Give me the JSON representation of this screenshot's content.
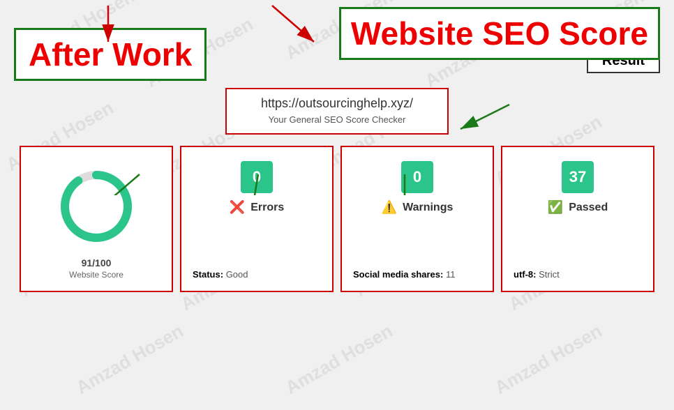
{
  "watermarks": [
    "Amzad Hosen",
    "Amzad Hosen",
    "Amzad Hosen",
    "Amzad Hosen",
    "Amzad Hosen",
    "Amzad Hosen",
    "Amzad Hosen",
    "Amzad Hosen",
    "Amzad Hosen"
  ],
  "header": {
    "after_work_label": "After Work",
    "result_label": "Result",
    "seo_score_label": "Website SEO Score"
  },
  "url_section": {
    "url": "https://outsourcinghelp.xyz/",
    "subtitle": "Your General SEO Score Checker"
  },
  "cards": [
    {
      "type": "score",
      "score_text": "91/100",
      "score_label": "Website Score",
      "score_percent": 91
    },
    {
      "type": "badge",
      "badge_value": "0",
      "icon": "error",
      "icon_label": "Errors",
      "status_label": "Status:",
      "status_value": "Good"
    },
    {
      "type": "badge",
      "badge_value": "0",
      "icon": "warning",
      "icon_label": "Warnings",
      "status_label": "Social media shares:",
      "status_value": "11"
    },
    {
      "type": "badge",
      "badge_value": "37",
      "icon": "pass",
      "icon_label": "Passed",
      "status_label": "utf-8:",
      "status_value": "Strict"
    }
  ]
}
